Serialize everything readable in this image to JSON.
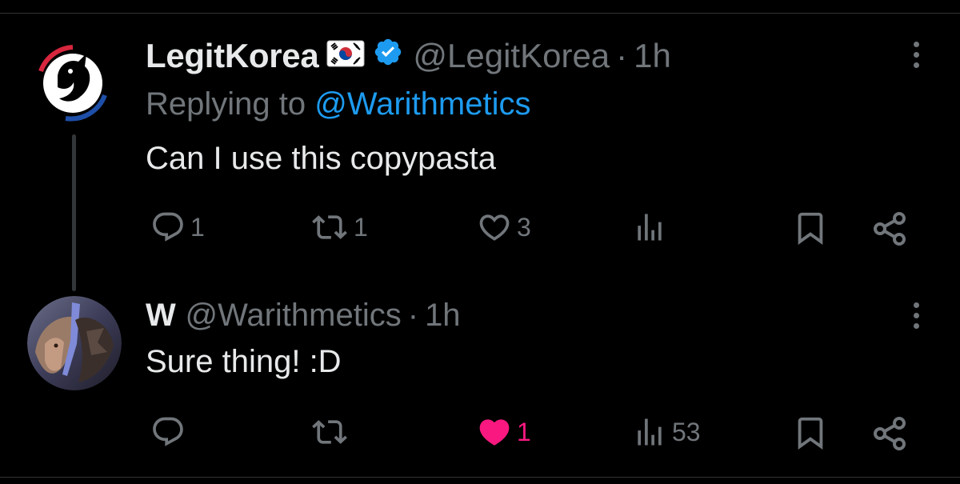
{
  "colors": {
    "background": "#000000",
    "text_primary": "#e7e9ea",
    "text_secondary": "#71767b",
    "link": "#1d9bf0",
    "verified": "#1d9bf0",
    "like_active": "#f91880"
  },
  "tweet1": {
    "display_name": "LegitKorea",
    "flag_icon": "south-korea-flag-icon",
    "verified_icon": "verified-badge-icon",
    "handle": "@LegitKorea",
    "separator": "·",
    "time": "1h",
    "replying_prefix": "Replying to ",
    "replying_to": "@Warithmetics",
    "text": "Can I use this copypasta",
    "actions": {
      "reply_count": "1",
      "retweet_count": "1",
      "like_count": "3",
      "views_count": ""
    }
  },
  "tweet2": {
    "display_name": "W",
    "handle": "@Warithmetics",
    "separator": "·",
    "time": "1h",
    "text": "Sure thing! :D",
    "actions": {
      "reply_count": "",
      "retweet_count": "",
      "like_count": "1",
      "like_state": "liked",
      "views_count": "53"
    }
  }
}
